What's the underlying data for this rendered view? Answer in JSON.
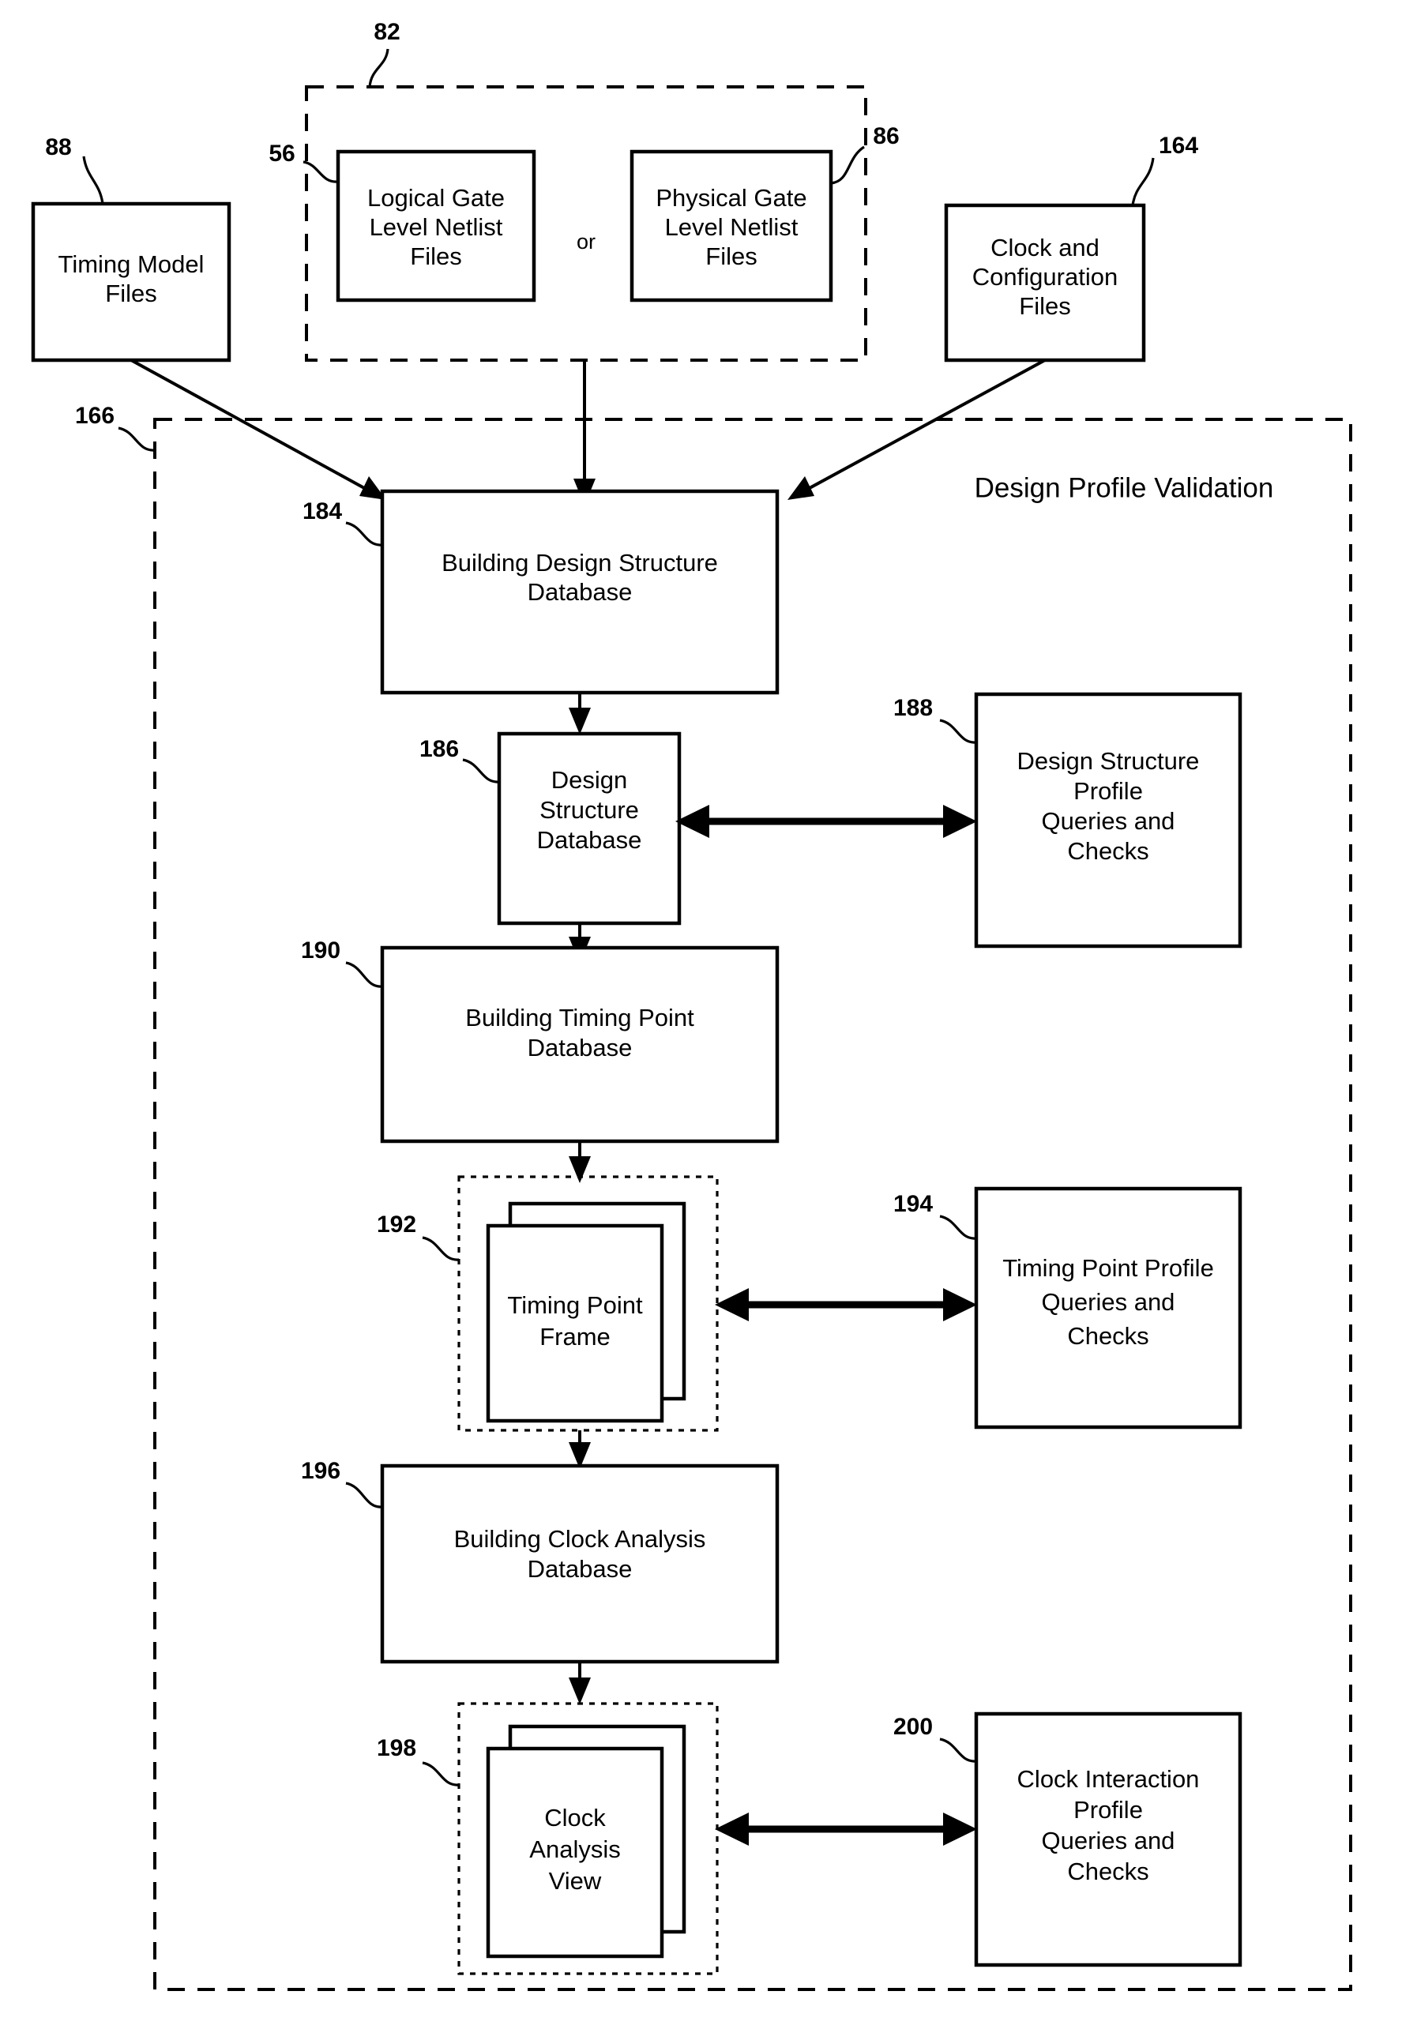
{
  "figure": {
    "title": "Design Profile Validation",
    "top_group_ref": "82",
    "main_group_ref": "166"
  },
  "inputs": [
    {
      "id": "timing-model-files",
      "ref": "88",
      "lines": [
        "Timing Model",
        "Files"
      ]
    },
    {
      "id": "logical-gate-level-netlist-files",
      "ref": "56",
      "lines": [
        "Logical Gate",
        "Level Netlist",
        "Files"
      ]
    },
    {
      "id": "physical-gate-level-netlist-files",
      "ref": "86",
      "lines": [
        "Physical Gate",
        "Level Netlist",
        "Files"
      ]
    },
    {
      "id": "clock-and-configuration-files",
      "ref": "164",
      "lines": [
        "Clock and",
        "Configuration",
        "Files"
      ]
    }
  ],
  "connector": {
    "or_label": "or"
  },
  "process_steps": [
    {
      "id": "building-design-structure-database",
      "ref": "184",
      "lines": [
        "Building Design Structure",
        "Database"
      ]
    },
    {
      "id": "design-structure-database",
      "ref": "186",
      "lines": [
        "Design",
        "Structure",
        "Database"
      ]
    },
    {
      "id": "building-timing-point-database",
      "ref": "190",
      "lines": [
        "Building Timing Point",
        "Database"
      ]
    },
    {
      "id": "timing-point-frame",
      "ref": "192",
      "lines": [
        "Timing Point",
        "Frame"
      ]
    },
    {
      "id": "building-clock-analysis-database",
      "ref": "196",
      "lines": [
        "Building Clock Analysis",
        "Database"
      ]
    },
    {
      "id": "clock-analysis-view",
      "ref": "198",
      "lines": [
        "Clock",
        "Analysis",
        "View"
      ]
    }
  ],
  "query_boxes": [
    {
      "id": "design-structure-profile-queries-and-checks",
      "ref": "188",
      "lines": [
        "Design Structure",
        "Profile",
        "Queries and",
        "Checks"
      ]
    },
    {
      "id": "timing-point-profile-queries-and-checks",
      "ref": "194",
      "lines": [
        "Timing Point Profile",
        "Queries and",
        "Checks"
      ]
    },
    {
      "id": "clock-interaction-profile-queries-and-checks",
      "ref": "200",
      "lines": [
        "Clock Interaction",
        "Profile",
        "Queries and",
        "Checks"
      ]
    }
  ],
  "colors": {
    "ink": "#000000",
    "paper": "#ffffff"
  }
}
